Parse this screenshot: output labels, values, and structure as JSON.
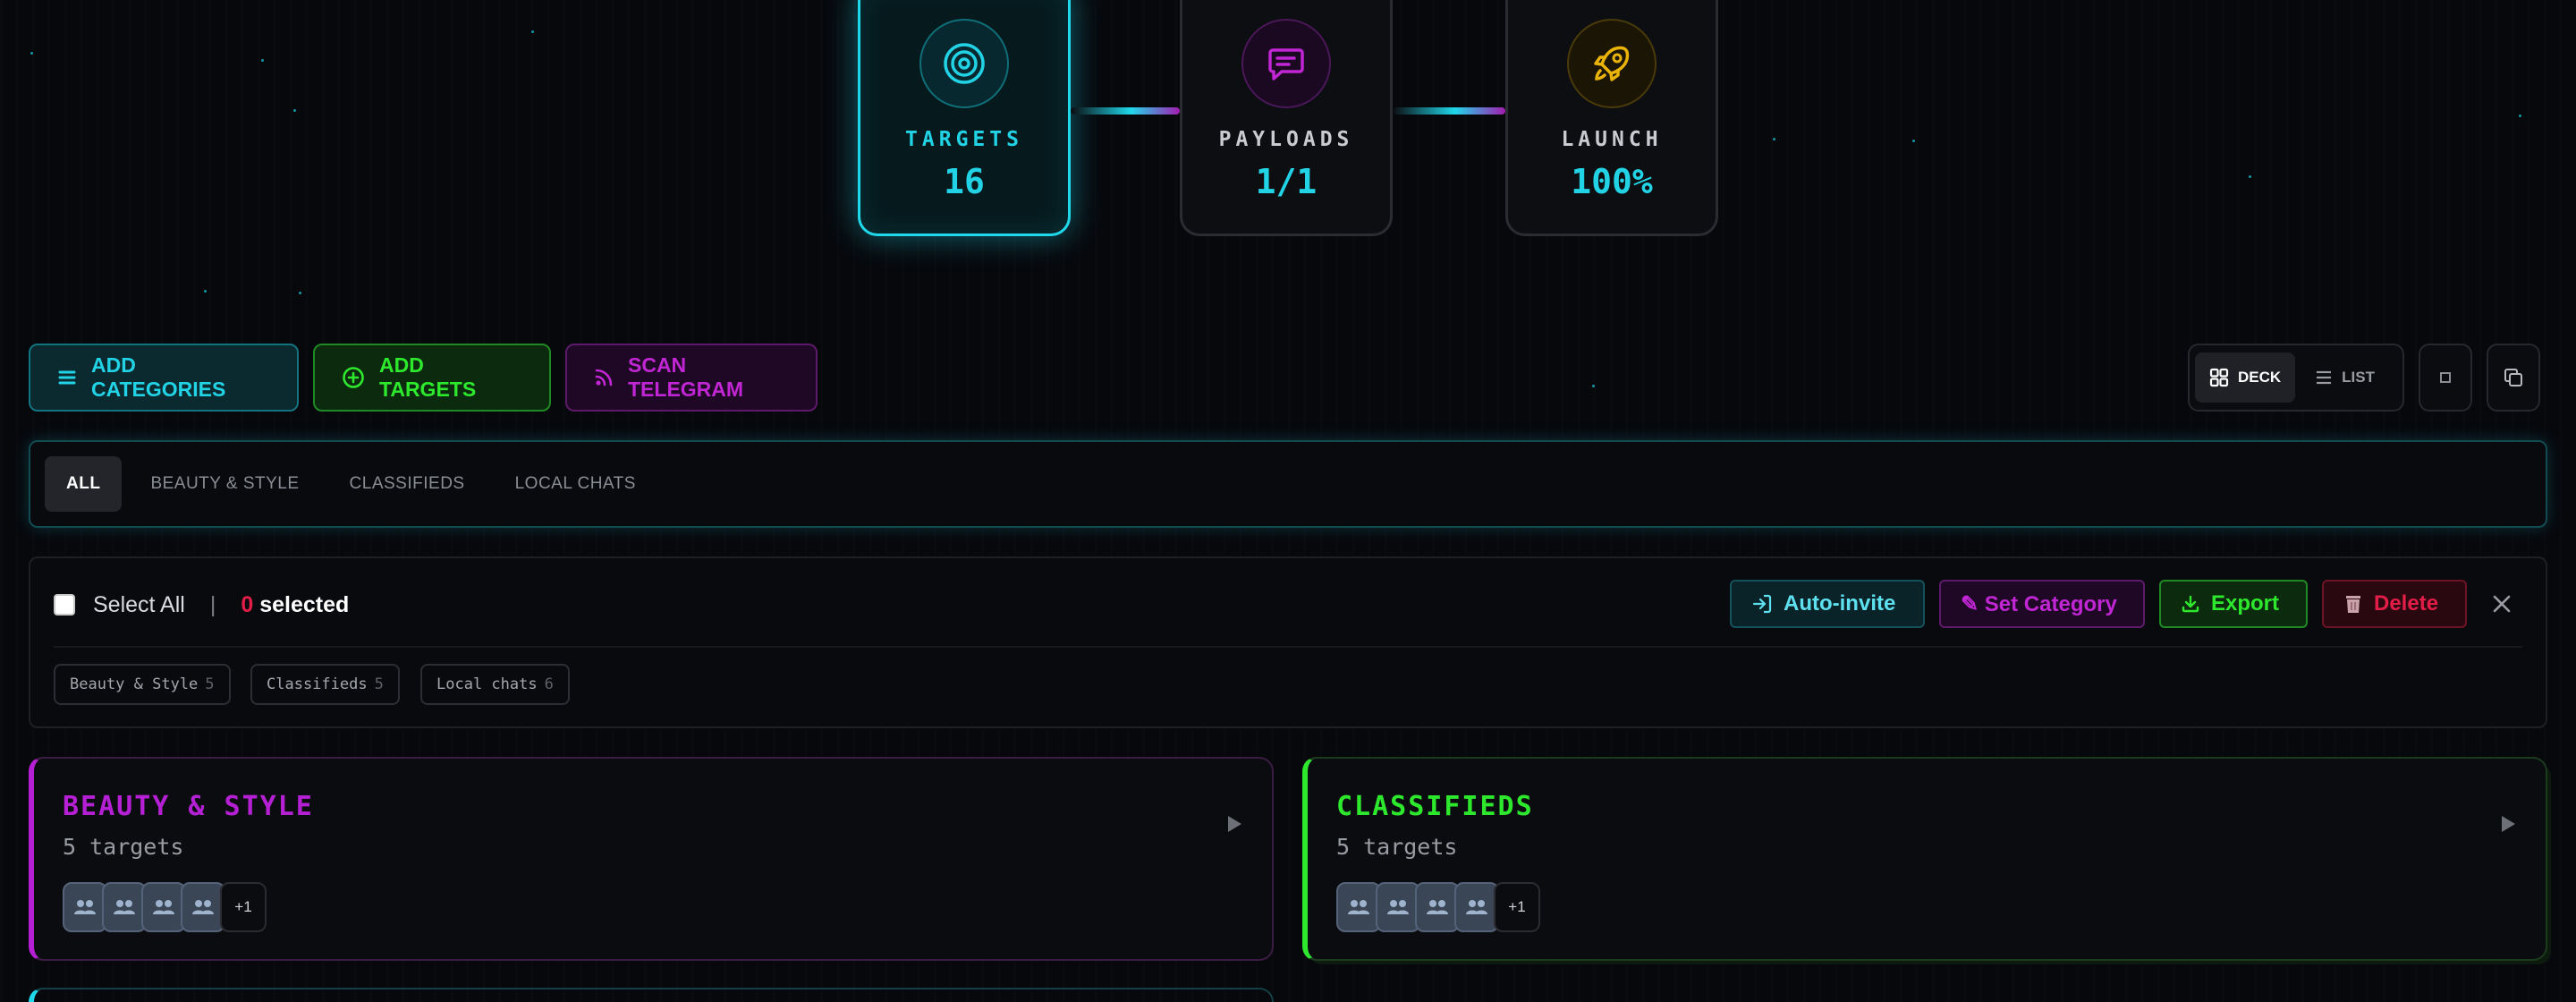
{
  "pipeline": {
    "stages": [
      {
        "label": "TARGETS",
        "value": "16",
        "icon": "target-icon",
        "color": "#22d3e6"
      },
      {
        "label": "PAYLOADS",
        "value": "1/1",
        "icon": "message-icon",
        "color": "#c026d3"
      },
      {
        "label": "LAUNCH",
        "value": "100%",
        "icon": "rocket-icon",
        "color": "#eab308"
      }
    ]
  },
  "toolbar": {
    "add_categories": "ADD CATEGORIES",
    "add_targets": "ADD TARGETS",
    "scan_telegram": "SCAN TELEGRAM",
    "view_deck": "DECK",
    "view_list": "LIST"
  },
  "filters": {
    "tabs": [
      "ALL",
      "BEAUTY & STYLE",
      "CLASSIFIEDS",
      "LOCAL CHATS"
    ],
    "active": "ALL"
  },
  "selection": {
    "select_all": "Select All",
    "separator": "|",
    "count": "0",
    "selected_word": "selected",
    "actions": {
      "auto_invite": "Auto-invite",
      "set_category": "✎ Set Category",
      "export": "Export",
      "delete": "Delete"
    },
    "chips": [
      {
        "name": "Beauty & Style",
        "count": "5"
      },
      {
        "name": "Classifieds",
        "count": "5"
      },
      {
        "name": "Local chats",
        "count": "6"
      }
    ]
  },
  "categories": [
    {
      "title": "BEAUTY & STYLE",
      "count_text": "5 targets",
      "more": "+1",
      "accent": "#b620d4"
    },
    {
      "title": "CLASSIFIEDS",
      "count_text": "5 targets",
      "more": "+1",
      "accent": "#2ee82e"
    }
  ],
  "colors": {
    "cyan": "#22d3e6",
    "green": "#2ee82e",
    "magenta": "#c026d3",
    "red": "#e11d48",
    "yellow": "#eab308"
  }
}
